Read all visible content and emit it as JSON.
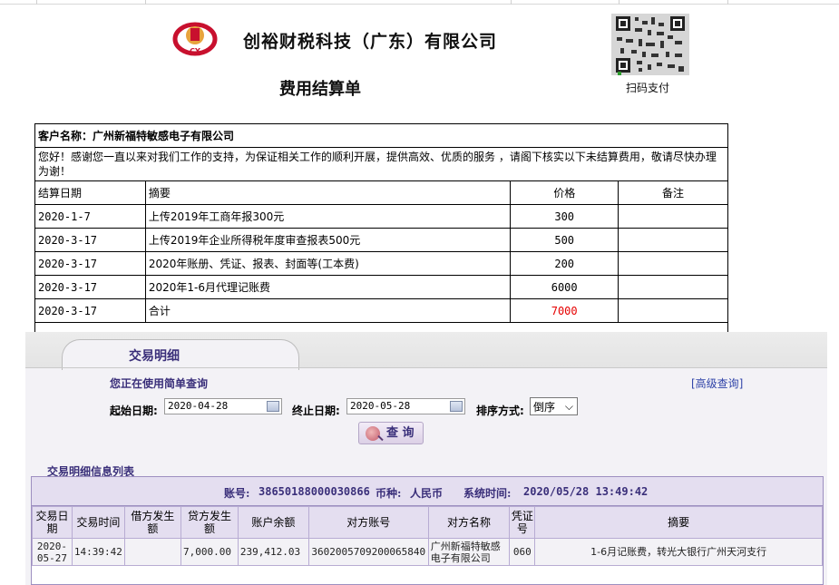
{
  "header": {
    "company": "创裕财税科技（广东）有限公司",
    "title": "费用结算单",
    "qr_caption": "扫码支付"
  },
  "statement": {
    "customer_label": "客户名称：广州新福特敏感电子有限公司",
    "message": "您好！感谢您一直以来对我们工作的支持，为保证相关工作的顺利开展，提供高效、优质的服务 ，请阁下核实以下未结算费用，敬请尽快办理为谢！",
    "columns": [
      "结算日期",
      "摘要",
      "价格",
      "备注"
    ],
    "rows": [
      {
        "date": "2020-1-7",
        "summary": "上传2019年工商年报300元",
        "price": "300",
        "note": ""
      },
      {
        "date": "2020-3-17",
        "summary": "上传2019年企业所得税年度审查报表500元",
        "price": "500",
        "note": ""
      },
      {
        "date": "2020-3-17",
        "summary": "2020年账册、凭证、报表、封面等(工本费)",
        "price": "200",
        "note": ""
      },
      {
        "date": "2020-3-17",
        "summary": "2020年1-6月代理记账费",
        "price": "6000",
        "note": ""
      },
      {
        "date": "2020-3-17",
        "summary": "合计",
        "price": "7000",
        "note": ""
      }
    ],
    "total_color": "#e60000"
  },
  "bank": {
    "tab_label": "交易明细",
    "notice": "您正在使用简单查询",
    "advanced_link": "[高级查询]",
    "start_label": "起始日期:",
    "start_value": "2020-04-28",
    "end_label": "终止日期:",
    "end_value": "2020-05-28",
    "sort_label": "排序方式:",
    "sort_value": "倒序",
    "query_button": "查 询",
    "list_title": "交易明细信息列表",
    "account_label": "账号:",
    "account_value": "38650188000030866",
    "currency_label": "币种:",
    "currency_value": "人民币",
    "systime_label": "系统时间:",
    "systime_value": "2020/05/28 13:49:42",
    "columns": [
      "交易日期",
      "交易时间",
      "借方发生额",
      "贷方发生额",
      "账户余额",
      "对方账号",
      "对方名称",
      "凭证号",
      "摘要"
    ],
    "rows": [
      {
        "date": "2020-05-27",
        "time": "14:39:42",
        "debit": "",
        "credit": "7,000.00",
        "balance": "239,412.03",
        "counter_account": "3602005709200065840",
        "counter_name": "广州新福特敏感电子有限公司",
        "voucher": "060",
        "summary": "1-6月记账费，转光大银行广州天河支行"
      }
    ]
  }
}
